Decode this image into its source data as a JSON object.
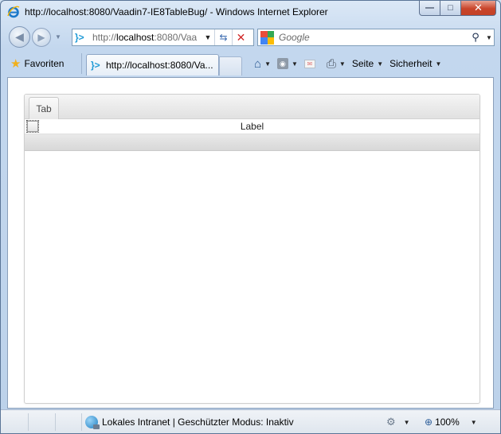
{
  "window": {
    "title": "http://localhost:8080/Vaadin7-IE8TableBug/ - Windows Internet Explorer",
    "minimize_glyph": "—",
    "maximize_glyph": "□",
    "close_glyph": "✕"
  },
  "nav": {
    "back_glyph": "◀",
    "forward_glyph": "▶",
    "address_prefix": "http://",
    "address_host": "localhost",
    "address_rest": ":8080/Vaa",
    "search_placeholder": "Google"
  },
  "command_bar": {
    "favorites_label": "Favoriten",
    "tab_label": "http://localhost:8080/Va...",
    "page_label": "Seite",
    "security_label": "Sicherheit"
  },
  "app": {
    "tab_caption": "Tab",
    "table_rows": [
      {
        "checked": false,
        "label": "Label"
      }
    ]
  },
  "status_bar": {
    "zone_text": "Lokales Intranet | Geschützter Modus: Inaktiv",
    "zoom_text": "100%"
  },
  "colors": {
    "close_button": "#c9452b",
    "frame": "#bcd2ea",
    "link_icon": "#1f9ad6"
  }
}
